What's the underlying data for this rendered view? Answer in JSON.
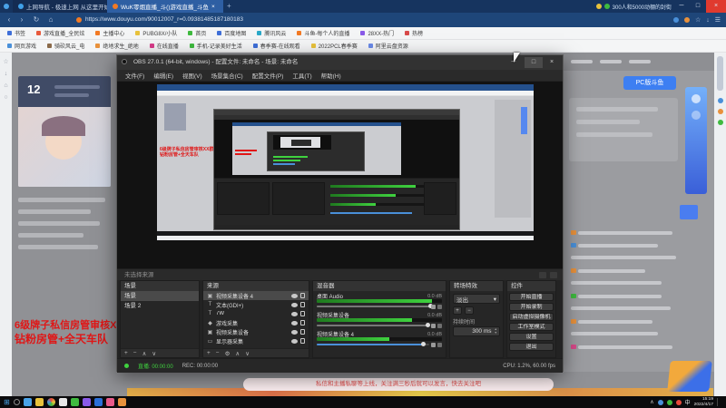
{
  "icons": {
    "back": "‹",
    "forward": "›",
    "refresh": "↻",
    "home": "⌂",
    "star": "☆",
    "down": "↓",
    "menu": "☰",
    "search": "○",
    "plus": "+",
    "minus": "−",
    "up": "∧",
    "dn": "∨",
    "caret": "▾",
    "min": "─",
    "max": "□",
    "close": "×",
    "start": "⊞",
    "tray": "∧",
    "gear": "⚙",
    "src_cam": "▣",
    "src_txt": "T",
    "src_game": "◆",
    "src_disp": "▭",
    "spin_up": "▲",
    "spin_dn": "▼",
    "new_tab": "+"
  },
  "browser": {
    "tab1": "上网导航 - 极速上网 从这里开始",
    "tab2": "WuK零烟直播_斗()游戏直播_斗鱼",
    "notice": "300人和5000动棚的封街",
    "url": "https://www.douyu.com/90012007_r=0.09381485187180183",
    "bookmarks_row1": [
      "书签",
      "游戏直播_全民炫",
      "主播中心",
      "PUBG8X/小队",
      "首页",
      "百度地图",
      "腾讯风云",
      "斗鱼-每个人的直播",
      "28XX-热门",
      "热榜"
    ],
    "bookmarks_row2": [
      "网页游戏",
      "骑砍风云_电",
      "绝地求生_绝地",
      "在线直播",
      "手机-记录美好生活",
      "春季赛-在线观看",
      "2022PCL春季赛",
      "阿里云盘资源"
    ]
  },
  "page": {
    "rank_number": "12",
    "red_line1": "6级牌子私信房管审核XX群",
    "red_line2": "钻粉房管+全天车队",
    "pc_button": "PC版斗鱼",
    "notice": "私信和主播私聊等上线，关注满三秒后就可以发言，快去关注吧"
  },
  "obs": {
    "title": "OBS 27.0.1 (64-bit, windows) - 配置文件: 未命名 - 场景: 未命名",
    "menus": [
      "文件(F)",
      "编辑(E)",
      "视图(V)",
      "场景集合(C)",
      "配置文件(P)",
      "工具(T)",
      "帮助(H)"
    ],
    "context_hint": "未选择来源",
    "scenes": {
      "title": "场景",
      "items": [
        "场景",
        "场景 2"
      ]
    },
    "sources": {
      "title": "来源",
      "items": [
        {
          "label": "视频采集设备 4"
        },
        {
          "label": "文本(GDI+)"
        },
        {
          "label": "7W"
        },
        {
          "label": "游戏采集"
        },
        {
          "label": "视频采集设备"
        },
        {
          "label": "显示器采集"
        }
      ]
    },
    "mixer": {
      "title": "混音器",
      "channels": [
        {
          "name": "桌面 Audio",
          "db": "0.0 dB",
          "meter_style": "width:92%",
          "fill_style": "width:90%",
          "knob_style": "left:89%"
        },
        {
          "name": "视频采集设备",
          "db": "0.0 dB",
          "meter_style": "width:76%",
          "fill_style": "width:88%",
          "knob_style": "left:87%"
        },
        {
          "name": "视频采集设备 4",
          "db": "0.0 dB",
          "meter_style": "width:58%",
          "fill_style": "width:84%;background:#4a90d9",
          "knob_style": "left:83%"
        }
      ]
    },
    "transitions": {
      "title": "转场特效",
      "selected": "淡出",
      "duration_label": "持续时间",
      "duration": "300 ms"
    },
    "controls": {
      "title": "控件",
      "buttons": [
        "开始直播",
        "开始录制",
        "启动虚拟摄像机",
        "工作室模式",
        "设置",
        "退出"
      ]
    },
    "status": {
      "live": "直播: 00:00:00",
      "rec": "REC: 00:00:00",
      "perf": "CPU: 1.2%, 60.00 fps"
    }
  },
  "taskbar": {
    "ime": "中",
    "time": "15:19",
    "date": "2022/4/17"
  }
}
